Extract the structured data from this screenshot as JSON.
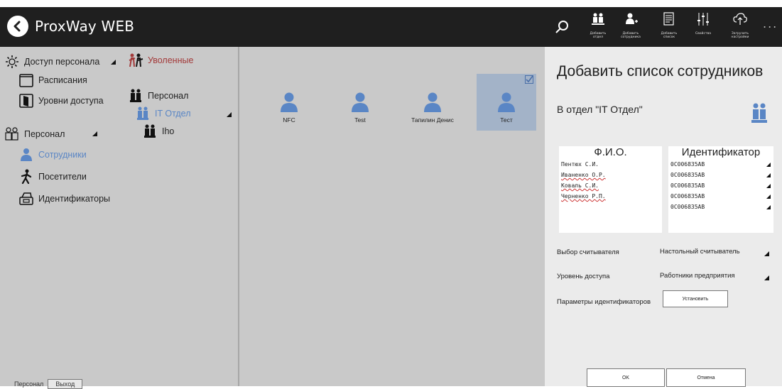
{
  "header": {
    "app_title": "ProxWay WEB",
    "buttons": [
      {
        "label": "Добавить\nотдел",
        "icon": "add-department-icon"
      },
      {
        "label": "Добавить\nсотрудника",
        "icon": "add-employee-icon"
      },
      {
        "label": "Добавить\nсписок",
        "icon": "add-list-icon"
      },
      {
        "label": "Свойства",
        "icon": "properties-icon"
      },
      {
        "label": "Загрузить\nнастройки",
        "icon": "upload-cloud-icon"
      }
    ],
    "more": "..."
  },
  "sidebar": {
    "access_group": "Доступ персонала",
    "schedules": "Расписания",
    "access_levels": "Уровни доступа",
    "personnel_group": "Персонал",
    "employees": "Сотрудники",
    "visitors": "Посетители",
    "identifiers": "Идентификаторы",
    "footer_label": "Персонал",
    "exit_button": "Выход"
  },
  "tree": {
    "fired": "Уволенные",
    "personnel": "Персонал",
    "it_dept": "IT Отдел",
    "iho": "Iho"
  },
  "employees": [
    {
      "name": "NFC",
      "selected": false
    },
    {
      "name": "Test",
      "selected": false
    },
    {
      "name": "Тапилин Денис",
      "selected": false
    },
    {
      "name": "Тест",
      "selected": true
    }
  ],
  "dialog": {
    "title": "Добавить список сотрудников",
    "subtitle": "В отдел \"IT Отдел\"",
    "col_fio": "Ф.И.О.",
    "col_id": "Идентификатор",
    "rows": [
      {
        "fio": "Пентюх С.И.",
        "id": "0C006835AB"
      },
      {
        "fio": "Иваненко О.Р.",
        "id": "0C006835AB"
      },
      {
        "fio": "Коваль С.И.",
        "id": "0C006835AB"
      },
      {
        "fio": "Черненко Р.П.",
        "id": "0C006835AB"
      },
      {
        "fio": "",
        "id": "0C006835AB"
      }
    ],
    "reader_label": "Выбор считывателя",
    "reader_value": "Настольный считыватель",
    "level_label": "Уровень доступа",
    "level_value": "Работники предприятия",
    "id_params_label": "Параметры идентификаторов",
    "set_button": "Установить",
    "ok_button": "OK",
    "cancel_button": "Отмена"
  },
  "colors": {
    "header_bg": "#1f1f1f",
    "panel_bg": "#c9c9c9",
    "dialog_bg": "#ebebeb",
    "accent_blue": "#5a86c5",
    "fired_red": "#a33a3a",
    "selected_tile": "#a3b3c8"
  }
}
